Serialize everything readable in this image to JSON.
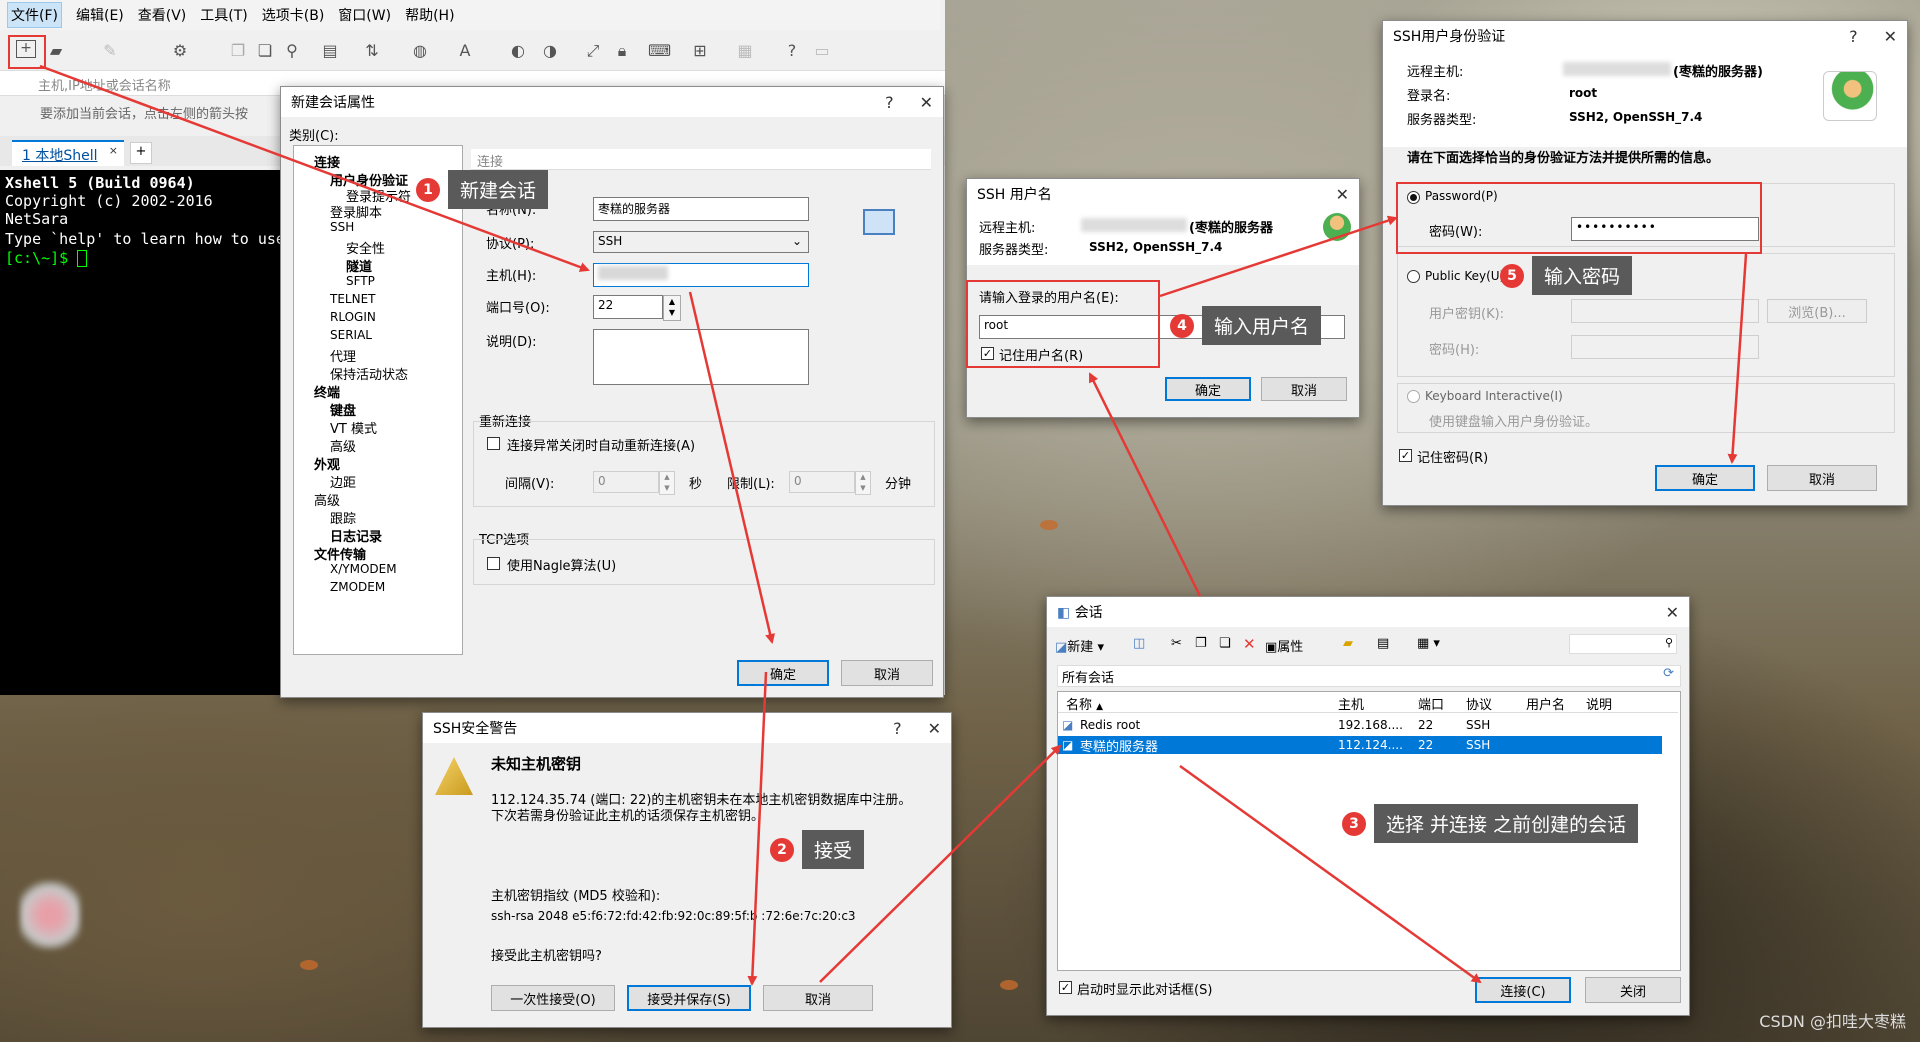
{
  "xshell": {
    "menu": [
      "文件(F)",
      "编辑(E)",
      "查看(V)",
      "工具(T)",
      "选项卡(B)",
      "窗口(W)",
      "帮助(H)"
    ],
    "address_placeholder": "主机,IP地址或会话名称",
    "hint": "要添加当前会话，点击左侧的箭头按",
    "tab_label": "1 本地Shell",
    "terminal_lines": [
      "Xshell 5 (Build 0964)",
      "Copyright (c) 2002-2016 NetSara",
      "",
      "Type `help' to learn how to use",
      "[c:\\~]$ "
    ]
  },
  "new_session": {
    "title": "新建会话属性",
    "category_label": "类别(C):",
    "tree": [
      "连接",
      "用户身份验证",
      "登录提示符",
      "登录脚本",
      "SSH",
      "安全性",
      "隧道",
      "SFTP",
      "TELNET",
      "RLOGIN",
      "SERIAL",
      "代理",
      "保持活动状态",
      "终端",
      "键盘",
      "VT 模式",
      "高级",
      "外观",
      "边距",
      "高级",
      "跟踪",
      "日志记录",
      "文件传输",
      "X/YMODEM",
      "ZMODEM"
    ],
    "section_title": "连接",
    "name_label": "名称(N):",
    "name_value": "枣糕的服务器",
    "protocol_label": "协议(P):",
    "protocol_value": "SSH",
    "host_label": "主机(H):",
    "port_label": "端口号(O):",
    "port_value": "22",
    "desc_label": "说明(D):",
    "reconnect_group": "重新连接",
    "reconnect_check": "连接异常关闭时自动重新连接(A)",
    "interval_label": "间隔(V):",
    "interval_value": "0",
    "sec_unit": "秒",
    "limit_label": "限制(L):",
    "limit_value": "0",
    "min_unit": "分钟",
    "tcp_group": "TCP选项",
    "nagle_check": "使用Nagle算法(U)",
    "ok": "确定",
    "cancel": "取消"
  },
  "security_warning": {
    "title": "SSH安全警告",
    "heading": "未知主机密钥",
    "message": "112.124.35.74 (端口: 22)的主机密钥未在本地主机密钥数据库中注册。下次若需身份验证此主机的话须保存主机密钥。",
    "fingerprint_label": "主机密钥指纹 (MD5 校验和):",
    "fingerprint": "ssh-rsa 2048 e5:f6:72:fd:42:fb:92:0c:89:5f:b  :72:6e:7c:20:c3",
    "question": "接受此主机密钥吗?",
    "once": "一次性接受(O)",
    "accept_save": "接受并保存(S)",
    "cancel": "取消"
  },
  "ssh_user": {
    "title": "SSH 用户名",
    "remote_label": "远程主机:",
    "remote_value": "(枣糕的服务器",
    "server_type_label": "服务器类型:",
    "server_type_value": "SSH2, OpenSSH_7.4",
    "prompt": "请输入登录的用户名(E):",
    "username": "root",
    "remember": "记住用户名(R)",
    "ok": "确定",
    "cancel": "取消"
  },
  "auth": {
    "title": "SSH用户身份验证",
    "remote_label": "远程主机:",
    "remote_value": "(枣糕的服务器)",
    "login_label": "登录名:",
    "login_value": "root",
    "server_type_label": "服务器类型:",
    "server_type_value": "SSH2, OpenSSH_7.4",
    "instruction": "请在下面选择恰当的身份验证方法并提供所需的信息。",
    "password_radio": "Password(P)",
    "password_label": "密码(W):",
    "password_value": "••••••••••",
    "pubkey_radio": "Public Key(U)",
    "user_key_label": "用户密钥(K):",
    "browse": "浏览(B)...",
    "passphrase_label": "密码(H):",
    "kbd_radio": "Keyboard Interactive(I)",
    "kbd_desc": "使用键盘输入用户身份验证。",
    "remember_pwd": "记住密码(R)",
    "ok": "确定",
    "cancel": "取消"
  },
  "sessions": {
    "title": "会话",
    "new": "新建",
    "props": "属性",
    "all_sessions": "所有会话",
    "columns": [
      "名称",
      "主机",
      "端口",
      "协议",
      "用户名",
      "说明"
    ],
    "rows": [
      {
        "name": "Redis root",
        "host": "192.168....",
        "port": "22",
        "protocol": "SSH"
      },
      {
        "name": "枣糕的服务器",
        "host": "112.124....",
        "port": "22",
        "protocol": "SSH"
      }
    ],
    "startup_check": "启动时显示此对话框(S)",
    "connect": "连接(C)",
    "close": "关闭"
  },
  "callouts": [
    {
      "num": "1",
      "text": "新建会话"
    },
    {
      "num": "2",
      "text": "接受"
    },
    {
      "num": "3",
      "text": "选择 并连接 之前创建的会话"
    },
    {
      "num": "4",
      "text": "输入用户名"
    },
    {
      "num": "5",
      "text": "输入密码"
    }
  ],
  "watermark": "CSDN @扣哇大枣糕",
  "colors": {
    "accent": "#0078d7",
    "annotation_red": "#e53935",
    "selected_row": "#0078d7"
  }
}
